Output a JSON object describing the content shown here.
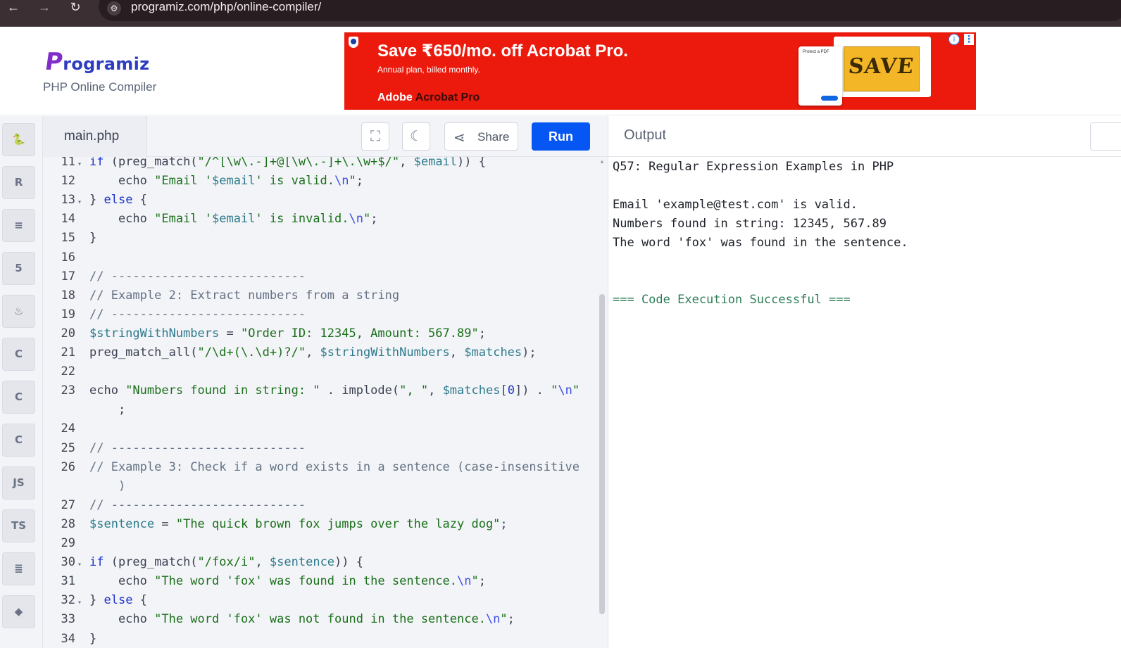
{
  "browser": {
    "url": "programiz.com/php/online-compiler/",
    "back_icon": "←",
    "forward_icon": "→",
    "reload_icon": "↻",
    "site_settings_icon": "⚙"
  },
  "header": {
    "logo_first": "P",
    "logo_rest": "rogramiz",
    "subtitle": "PHP Online Compiler"
  },
  "ad": {
    "headline": "Save ₹650/mo. off Acrobat Pro.",
    "subline": "Annual plan, billed monthly.",
    "brand": "Adobe",
    "product": "Acrobat Pro",
    "mock_art_text": "SAVE",
    "mock_panel_text": "Protect a PDF",
    "info_icon": "i",
    "menu_icon": "⋮"
  },
  "sidebar": {
    "items": [
      {
        "name": "python",
        "glyph": "🐍"
      },
      {
        "name": "r",
        "glyph": "R"
      },
      {
        "name": "sql",
        "glyph": "≡"
      },
      {
        "name": "html",
        "glyph": "5"
      },
      {
        "name": "java",
        "glyph": "♨"
      },
      {
        "name": "c",
        "glyph": "C"
      },
      {
        "name": "cpp",
        "glyph": "C"
      },
      {
        "name": "csharp",
        "glyph": "C"
      },
      {
        "name": "js",
        "glyph": "JS"
      },
      {
        "name": "ts",
        "glyph": "TS"
      },
      {
        "name": "go",
        "glyph": "≣"
      },
      {
        "name": "swift",
        "glyph": "◆"
      }
    ]
  },
  "editor": {
    "file_tab": "main.php",
    "fullscreen_icon": "⛶",
    "theme_icon": "☾",
    "share_icon": "⋖",
    "share_label": "Share",
    "run_label": "Run"
  },
  "code_lines": [
    {
      "n": "11",
      "fold": true
    },
    {
      "n": "12",
      "fold": false
    },
    {
      "n": "13",
      "fold": true
    },
    {
      "n": "14",
      "fold": false
    },
    {
      "n": "15",
      "fold": false
    },
    {
      "n": "16",
      "fold": false
    },
    {
      "n": "17",
      "fold": false
    },
    {
      "n": "18",
      "fold": false
    },
    {
      "n": "19",
      "fold": false
    },
    {
      "n": "20",
      "fold": false
    },
    {
      "n": "21",
      "fold": false
    },
    {
      "n": "22",
      "fold": false
    },
    {
      "n": "23",
      "fold": false
    },
    {
      "n": "",
      "fold": false
    },
    {
      "n": "24",
      "fold": false
    },
    {
      "n": "25",
      "fold": false
    },
    {
      "n": "26",
      "fold": false
    },
    {
      "n": "",
      "fold": false
    },
    {
      "n": "27",
      "fold": false
    },
    {
      "n": "28",
      "fold": false
    },
    {
      "n": "29",
      "fold": false
    },
    {
      "n": "30",
      "fold": true
    },
    {
      "n": "31",
      "fold": false
    },
    {
      "n": "32",
      "fold": true
    },
    {
      "n": "33",
      "fold": false
    },
    {
      "n": "34",
      "fold": false
    }
  ],
  "code_text": {
    "l11": [
      [
        "kw",
        "if"
      ],
      [
        "fn",
        " (preg_match("
      ],
      [
        "str",
        "\"/^[\\w\\.-]+@[\\w\\.-]+\\.\\w+$/\""
      ],
      [
        "fn",
        ", "
      ],
      [
        "var",
        "$email"
      ],
      [
        "fn",
        ")) {"
      ]
    ],
    "l12": [
      [
        "fn",
        "    echo "
      ],
      [
        "str",
        "\"Email '"
      ],
      [
        "var",
        "$email"
      ],
      [
        "str",
        "' is valid."
      ],
      [
        "esc",
        "\\n"
      ],
      [
        "str",
        "\""
      ],
      [
        "fn",
        ";"
      ]
    ],
    "l13": [
      [
        "fn",
        "} "
      ],
      [
        "kw",
        "else"
      ],
      [
        "fn",
        " {"
      ]
    ],
    "l14": [
      [
        "fn",
        "    echo "
      ],
      [
        "str",
        "\"Email '"
      ],
      [
        "var",
        "$email"
      ],
      [
        "str",
        "' is invalid."
      ],
      [
        "esc",
        "\\n"
      ],
      [
        "str",
        "\""
      ],
      [
        "fn",
        ";"
      ]
    ],
    "l15": [
      [
        "fn",
        "}"
      ]
    ],
    "l16": [],
    "l17": [
      [
        "cmt",
        "// ---------------------------"
      ]
    ],
    "l18": [
      [
        "cmt",
        "// Example 2: Extract numbers from a string"
      ]
    ],
    "l19": [
      [
        "cmt",
        "// ---------------------------"
      ]
    ],
    "l20": [
      [
        "var",
        "$stringWithNumbers"
      ],
      [
        "fn",
        " = "
      ],
      [
        "str",
        "\"Order ID: 12345, Amount: 567.89\""
      ],
      [
        "fn",
        ";"
      ]
    ],
    "l21": [
      [
        "fn",
        "preg_match_all("
      ],
      [
        "str",
        "\"/\\d+(\\.\\d+)?/\""
      ],
      [
        "fn",
        ", "
      ],
      [
        "var",
        "$stringWithNumbers"
      ],
      [
        "fn",
        ", "
      ],
      [
        "var",
        "$matches"
      ],
      [
        "fn",
        ");"
      ]
    ],
    "l22": [],
    "l23": [
      [
        "fn",
        "echo "
      ],
      [
        "str",
        "\"Numbers found in string: \""
      ],
      [
        "fn",
        " . implode("
      ],
      [
        "str",
        "\", \""
      ],
      [
        "fn",
        ", "
      ],
      [
        "var",
        "$matches"
      ],
      [
        "fn",
        "["
      ],
      [
        "kw",
        "0"
      ],
      [
        "fn",
        "]) . "
      ],
      [
        "str",
        "\""
      ],
      [
        "esc",
        "\\n"
      ],
      [
        "str",
        "\""
      ]
    ],
    "l23b": [
      [
        "fn",
        "    ;"
      ]
    ],
    "l24": [],
    "l25": [
      [
        "cmt",
        "// ---------------------------"
      ]
    ],
    "l26": [
      [
        "cmt",
        "// Example 3: Check if a word exists in a sentence (case-insensitive"
      ]
    ],
    "l26b": [
      [
        "cmt",
        "    )"
      ]
    ],
    "l27": [
      [
        "cmt",
        "// ---------------------------"
      ]
    ],
    "l28": [
      [
        "var",
        "$sentence"
      ],
      [
        "fn",
        " = "
      ],
      [
        "str",
        "\"The quick brown fox jumps over the lazy dog\""
      ],
      [
        "fn",
        ";"
      ]
    ],
    "l29": [],
    "l30": [
      [
        "kw",
        "if"
      ],
      [
        "fn",
        " (preg_match("
      ],
      [
        "str",
        "\"/fox/i\""
      ],
      [
        "fn",
        ", "
      ],
      [
        "var",
        "$sentence"
      ],
      [
        "fn",
        ")) {"
      ]
    ],
    "l31": [
      [
        "fn",
        "    echo "
      ],
      [
        "str",
        "\"The word 'fox' was found in the sentence."
      ],
      [
        "esc",
        "\\n"
      ],
      [
        "str",
        "\""
      ],
      [
        "fn",
        ";"
      ]
    ],
    "l32": [
      [
        "fn",
        "} "
      ],
      [
        "kw",
        "else"
      ],
      [
        "fn",
        " {"
      ]
    ],
    "l33": [
      [
        "fn",
        "    echo "
      ],
      [
        "str",
        "\"The word 'fox' was not found in the sentence."
      ],
      [
        "esc",
        "\\n"
      ],
      [
        "str",
        "\""
      ],
      [
        "fn",
        ";"
      ]
    ],
    "l34": [
      [
        "fn",
        "}"
      ]
    ]
  },
  "output": {
    "title": "Output",
    "lines": [
      "Q57: Regular Expression Examples in PHP",
      "",
      "Email 'example@test.com' is valid.",
      "Numbers found in string: 12345, 567.89",
      "The word 'fox' was found in the sentence.",
      "",
      "",
      "=== Code Execution Successful ==="
    ]
  }
}
